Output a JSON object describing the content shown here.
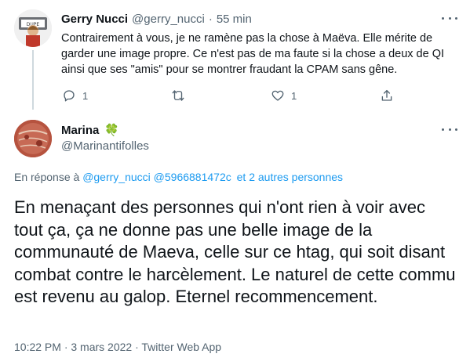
{
  "parent_tweet": {
    "display_name": "Gerry Nucci",
    "handle": "@gerry_nucci",
    "separator": "·",
    "time_ago": "55 min",
    "text": "Contrairement à vous, je ne ramène pas la chose à Maëva. Elle mérite de garder une image propre. Ce n'est pas de ma faute si la chose a deux de QI ainsi que ses \"amis\" pour se montrer fraudant la CPAM sans gêne.",
    "reply_count": "1",
    "like_count": "1",
    "icons": [
      "reply-icon",
      "retweet-icon",
      "like-icon",
      "share-icon",
      "more-icon"
    ]
  },
  "main_tweet": {
    "display_name": "Marina",
    "name_emoji": "🍀",
    "handle": "@Marinantifolles",
    "reply_prefix": "En réponse à",
    "reply_mentions": [
      "@gerry_nucci",
      "@5966881472c"
    ],
    "reply_others": "et 2 autres personnes",
    "text": "En menaçant des personnes qui n'ont rien à voir avec tout ça, ça ne donne pas une belle image de la communauté de Maeva, celle sur ce htag, qui soit disant combat contre le harcèlement. Le naturel de cette commu est revenu au galop. Eternel recommencement.",
    "meta": "10:22 PM · 3 mars 2022 · Twitter Web App",
    "icons": [
      "more-icon"
    ]
  },
  "colors": {
    "text": "#0f1419",
    "muted": "#536471",
    "link": "#1d9bf0",
    "thread_line": "#cfd9de"
  }
}
